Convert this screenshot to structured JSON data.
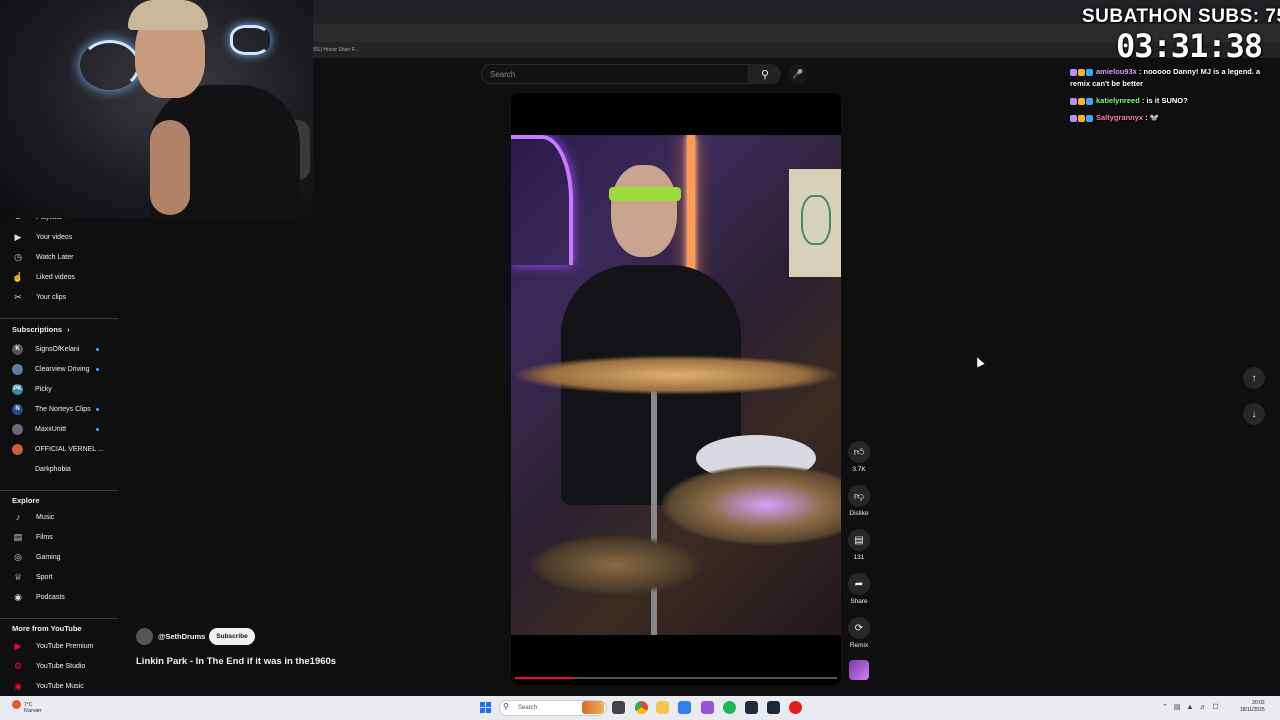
{
  "browser": {
    "bookmark_text": "301) Honor Short F..."
  },
  "overlay": {
    "subathon_label": "SUBATHON SUBS: 75",
    "timer": "03:31:38",
    "chat": [
      {
        "user": "amielou93x",
        "user_color": "#d6a8ff",
        "message": " : nooooo Danny! MJ is a legend. a remix can't be better"
      },
      {
        "user": "katielynreed",
        "user_color": "#7dff7d",
        "message": " : is it SUNO?"
      },
      {
        "user": "Saltygrannyx",
        "user_color": "#ff7ab4",
        "message": " : 🐭"
      }
    ]
  },
  "search": {
    "placeholder": "Search",
    "search_icon": "magnifier-icon",
    "mic_icon": "microphone-icon"
  },
  "sidebar": {
    "you_items": [
      {
        "label": "Playlists",
        "icon": "playlist-icon"
      },
      {
        "label": "Your videos",
        "icon": "video-icon"
      },
      {
        "label": "Watch Later",
        "icon": "clock-icon"
      },
      {
        "label": "Liked videos",
        "icon": "thumbs-up-icon"
      },
      {
        "label": "Your clips",
        "icon": "scissors-icon"
      }
    ],
    "subscriptions_heading": "Subscriptions",
    "subscriptions": [
      {
        "name": "SignsOfKelani",
        "avatar_color": "#555555",
        "initial": "K",
        "new": true
      },
      {
        "name": "Clearview Driving",
        "avatar_color": "#5d7ea0",
        "initial": "",
        "new": true
      },
      {
        "name": "Picky",
        "avatar_color": "#3a8a9a",
        "initial": "PK",
        "new": false
      },
      {
        "name": "The Norteys Clips",
        "avatar_color": "#2a4a8a",
        "initial": "N",
        "new": true
      },
      {
        "name": "MaxxUnitt",
        "avatar_color": "#6a6a7a",
        "initial": "",
        "new": true
      },
      {
        "name": "OFFICIAL VERNEL ...",
        "avatar_color": "#c8603a",
        "initial": "",
        "new": false
      },
      {
        "name": "Darkphobia",
        "avatar_color": "#101010",
        "initial": "",
        "new": false
      }
    ],
    "explore_heading": "Explore",
    "explore": [
      {
        "label": "Music",
        "icon": "music-note-icon"
      },
      {
        "label": "Films",
        "icon": "film-icon"
      },
      {
        "label": "Gaming",
        "icon": "gamepad-icon"
      },
      {
        "label": "Sport",
        "icon": "trophy-icon"
      },
      {
        "label": "Podcasts",
        "icon": "podcast-icon"
      }
    ],
    "more_heading": "More from YouTube",
    "more": [
      {
        "label": "YouTube Premium",
        "icon": "youtube-premium-icon"
      },
      {
        "label": "YouTube Studio",
        "icon": "youtube-studio-icon"
      },
      {
        "label": "YouTube Music",
        "icon": "youtube-music-icon"
      }
    ]
  },
  "short": {
    "channel": "@SethDrums",
    "subscribe_label": "Subscribe",
    "title": "Linkin Park - In The End if it was in the1960s",
    "progress": 0.18,
    "actions": {
      "like_count": "3.7K",
      "dislike_label": "Dislike",
      "comment_count": "131",
      "share_label": "Share",
      "remix_label": "Remix"
    }
  },
  "taskbar": {
    "weather_temp": "7°C",
    "weather_desc": "Klarvær",
    "search_placeholder": "Search",
    "time": "20:02",
    "date": "18/11/2025"
  }
}
